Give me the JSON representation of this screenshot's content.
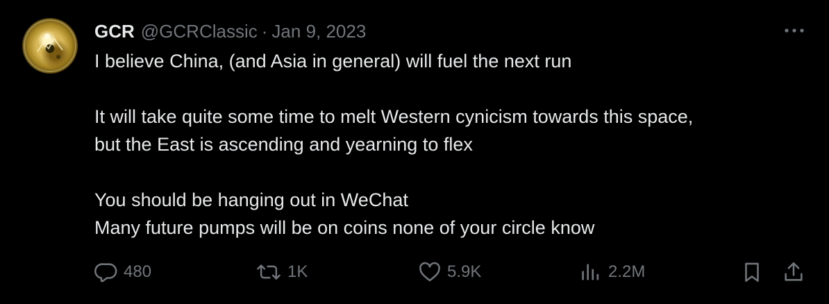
{
  "tweet": {
    "author_name": "GCR",
    "author_handle": "@GCRClassic",
    "separator": "·",
    "date": "Jan 9, 2023",
    "lines": [
      "I believe China, (and Asia in general) will fuel the next run",
      "It will take quite some time to melt Western cynicism towards this space,",
      "but the East is ascending and yearning to flex",
      "You should be hanging out in WeChat",
      "Many future pumps will be on coins none of your circle know"
    ]
  },
  "actions": {
    "replies": "480",
    "retweets": "1K",
    "likes": "5.9K",
    "views": "2.2M"
  },
  "icons": {
    "more": "more-horizontal-icon",
    "reply": "reply-icon",
    "retweet": "retweet-icon",
    "like": "heart-icon",
    "views": "analytics-icon",
    "bookmark": "bookmark-icon",
    "share": "share-icon"
  },
  "colors": {
    "background": "#000000",
    "text": "#e7e9ea",
    "muted": "#71767b"
  }
}
